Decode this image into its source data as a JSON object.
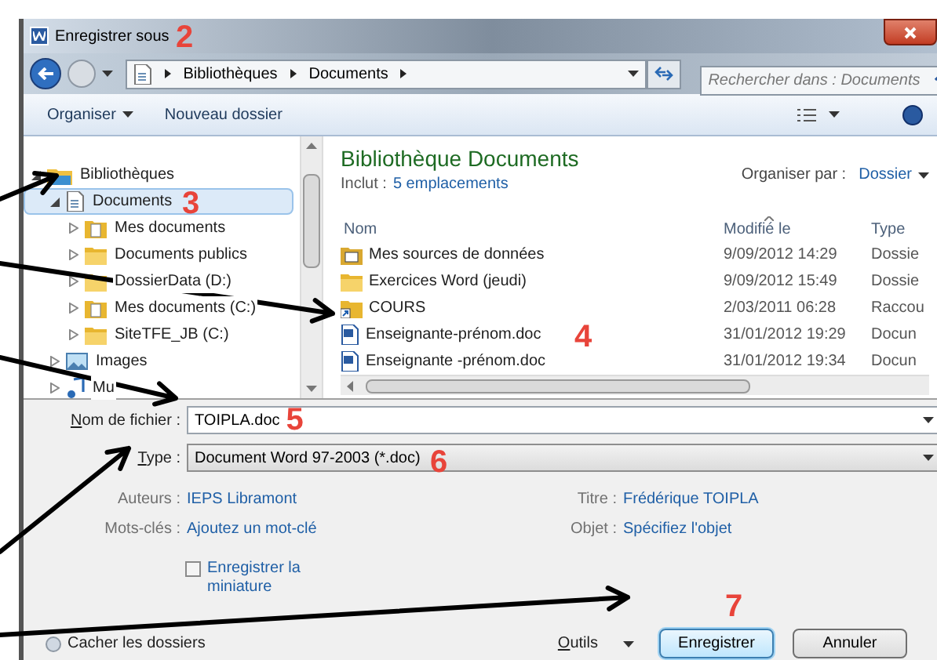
{
  "window": {
    "title": "Enregistrer sous"
  },
  "address": {
    "path": [
      "Bibliothèques",
      "Documents"
    ]
  },
  "search": {
    "placeholder": "Rechercher dans : Documents"
  },
  "toolbar": {
    "buttons": [
      {
        "label": "Organiser",
        "dropdown": true
      },
      {
        "label": "Nouveau dossier",
        "dropdown": false
      }
    ]
  },
  "nav": {
    "items": [
      {
        "label": "Bibliothèques",
        "kind": "library",
        "expanded": true,
        "selected": false,
        "children": [
          {
            "label": "Documents",
            "kind": "documents",
            "expanded": true,
            "selected": true,
            "children": [
              {
                "label": "Mes documents",
                "kind": "docfolder",
                "expanded": false,
                "selected": false
              },
              {
                "label": "Documents publics",
                "kind": "folder",
                "expanded": false,
                "selected": false
              },
              {
                "label": "DossierData (D:)",
                "kind": "folder",
                "expanded": false,
                "selected": false
              },
              {
                "label": "Mes documents (C:)",
                "kind": "docfolder",
                "expanded": false,
                "selected": false
              },
              {
                "label": "SiteTFE_JB (C:)",
                "kind": "folder",
                "expanded": false,
                "selected": false
              }
            ]
          },
          {
            "label": "Images",
            "kind": "images",
            "expanded": false,
            "selected": false
          },
          {
            "label": "Mu",
            "kind": "music",
            "expanded": false,
            "selected": false
          }
        ]
      }
    ]
  },
  "library": {
    "title": "Bibliothèque Documents",
    "includes_label": "Inclut :",
    "includes_link": "5 emplacements",
    "arrange_label": "Organiser par :",
    "arrange_value": "Dossier"
  },
  "file_list": {
    "columns": [
      {
        "label": "Nom",
        "sorted": false
      },
      {
        "label": "Modifié le",
        "sorted": true
      },
      {
        "label": "Type",
        "sorted": false
      }
    ],
    "rows": [
      {
        "name": "Mes sources de données",
        "modified": "9/09/2012 14:29",
        "type": "Dossie",
        "kind": "special"
      },
      {
        "name": "Exercices Word (jeudi)",
        "modified": "9/09/2012 15:49",
        "type": "Dossie",
        "kind": "folder"
      },
      {
        "name": "COURS",
        "modified": "2/03/2011 06:28",
        "type": "Raccou",
        "kind": "shortcut"
      },
      {
        "name": "Enseignante-prénom.doc",
        "modified": "31/01/2012 19:29",
        "type": "Docun",
        "kind": "word"
      },
      {
        "name": "Enseignante -prénom.doc",
        "modified": "31/01/2012 19:34",
        "type": "Docun",
        "kind": "word"
      }
    ]
  },
  "form": {
    "filename": {
      "label": "Nom de fichier :",
      "value": "TOIPLA.doc"
    },
    "type": {
      "label": "Type :",
      "value": "Document Word 97-2003 (*.doc)"
    }
  },
  "metadata": [
    {
      "label": "Auteurs :",
      "value": "IEPS Libramont"
    },
    {
      "label": "Titre :",
      "value": "Frédérique TOIPLA"
    },
    {
      "label": "Mots-clés :",
      "value": "Ajoutez un mot-clé"
    },
    {
      "label": "Objet :",
      "value": "Spécifiez l'objet"
    }
  ],
  "thumbnail": {
    "label": "Enregistrer la miniature",
    "checked": false
  },
  "footer": {
    "hide_folders": "Cacher les dossiers",
    "tools": "Outils",
    "buttons": [
      {
        "label": "Enregistrer",
        "default": true
      },
      {
        "label": "Annuler",
        "default": false
      }
    ]
  },
  "annotations": [
    {
      "label": "2"
    },
    {
      "label": "3"
    },
    {
      "label": "4"
    },
    {
      "label": "5"
    },
    {
      "label": "6"
    },
    {
      "label": "7"
    }
  ]
}
